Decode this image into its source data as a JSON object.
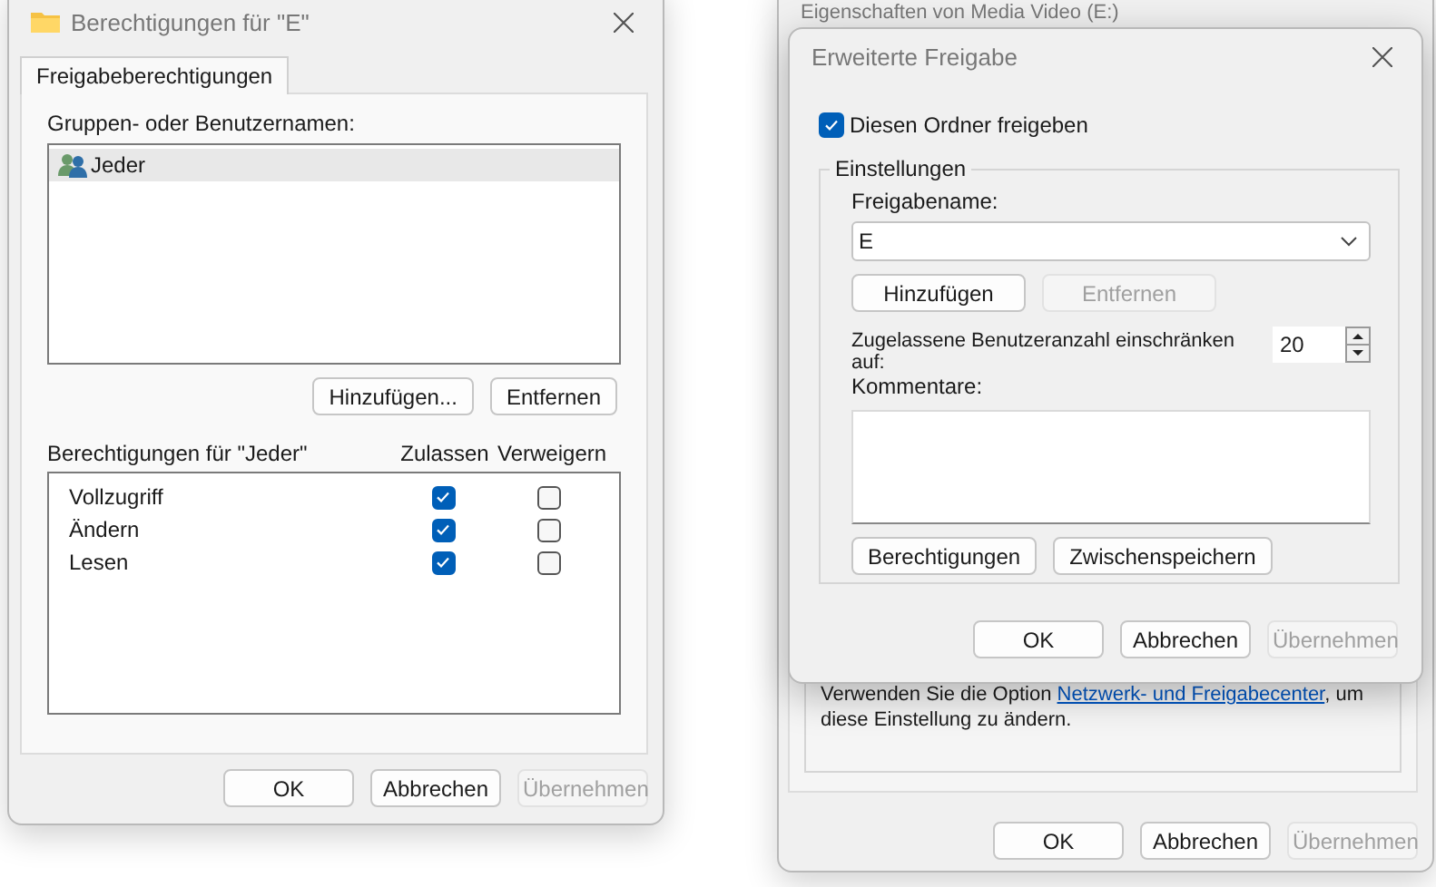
{
  "left_dialog": {
    "title": "Berechtigungen für \"E\"",
    "tabs": [
      {
        "label": "Freigabeberechtigungen",
        "selected": true
      }
    ],
    "users_label": "Gruppen- oder Benutzernamen:",
    "users": [
      {
        "name": "Jeder",
        "selected": true
      }
    ],
    "user_buttons": [
      {
        "label": "Hinzufügen...",
        "disabled": false
      },
      {
        "label": "Entfernen",
        "disabled": false
      }
    ],
    "permissions_label": "Berechtigungen für \"Jeder\"",
    "columns": [
      "Zulassen",
      "Verweigern"
    ],
    "permissions": [
      {
        "name": "Vollzugriff",
        "allow": true,
        "deny": false
      },
      {
        "name": "Ändern",
        "allow": true,
        "deny": false
      },
      {
        "name": "Lesen",
        "allow": true,
        "deny": false
      }
    ],
    "footer_buttons": [
      {
        "label": "OK",
        "disabled": false
      },
      {
        "label": "Abbrechen",
        "disabled": false
      },
      {
        "label": "Übernehmen",
        "disabled": true
      }
    ]
  },
  "back_dialog": {
    "title": "Eigenschaften von Media Video (E:)",
    "info": {
      "before": "Verwenden Sie die Option ",
      "link": "Netzwerk- und Freigabecenter",
      "after": ", um diese Einstellung zu ändern."
    },
    "footer_buttons": [
      {
        "label": "OK",
        "disabled": false
      },
      {
        "label": "Abbrechen",
        "disabled": false
      },
      {
        "label": "Übernehmen",
        "disabled": true
      }
    ]
  },
  "front_dialog": {
    "title": "Erweiterte Freigabe",
    "share": {
      "label": "Diesen Ordner freigeben",
      "checked": true
    },
    "group_label": "Einstellungen",
    "share_name_label": "Freigabename:",
    "share_name": "E",
    "name_buttons": [
      {
        "label": "Hinzufügen",
        "disabled": false
      },
      {
        "label": "Entfernen",
        "disabled": true
      }
    ],
    "limit_label": "Zugelassene Benutzeranzahl einschränken auf:",
    "limit": "20",
    "comments_label": "Kommentare:",
    "buttons": [
      {
        "label": "Berechtigungen",
        "disabled": false
      },
      {
        "label": "Zwischenspeichern",
        "disabled": false
      }
    ],
    "footer_buttons": [
      {
        "label": "OK",
        "disabled": false
      },
      {
        "label": "Abbrechen",
        "disabled": false
      },
      {
        "label": "Übernehmen",
        "disabled": true
      }
    ]
  }
}
